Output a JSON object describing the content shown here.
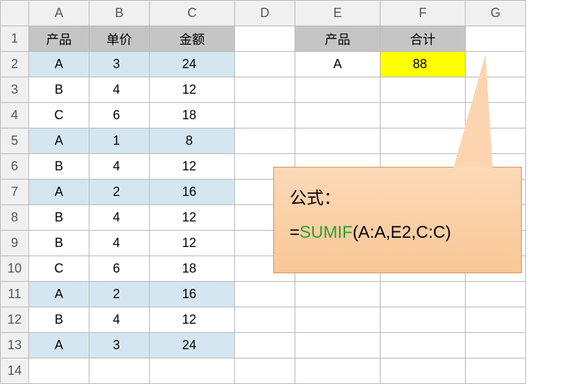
{
  "columns": [
    "A",
    "B",
    "C",
    "D",
    "E",
    "F",
    "G"
  ],
  "rowNumbers": [
    "1",
    "2",
    "3",
    "4",
    "5",
    "6",
    "7",
    "8",
    "9",
    "10",
    "11",
    "12",
    "13",
    "14"
  ],
  "mainHeaders": {
    "A": "产品",
    "B": "单价",
    "C": "金额"
  },
  "mainData": [
    {
      "product": "A",
      "price": "3",
      "amount": "24",
      "highlight": true
    },
    {
      "product": "B",
      "price": "4",
      "amount": "12",
      "highlight": false
    },
    {
      "product": "C",
      "price": "6",
      "amount": "18",
      "highlight": false
    },
    {
      "product": "A",
      "price": "1",
      "amount": "8",
      "highlight": true
    },
    {
      "product": "B",
      "price": "4",
      "amount": "12",
      "highlight": false
    },
    {
      "product": "A",
      "price": "2",
      "amount": "16",
      "highlight": true
    },
    {
      "product": "B",
      "price": "4",
      "amount": "12",
      "highlight": false
    },
    {
      "product": "B",
      "price": "4",
      "amount": "12",
      "highlight": false
    },
    {
      "product": "C",
      "price": "6",
      "amount": "18",
      "highlight": false
    },
    {
      "product": "A",
      "price": "2",
      "amount": "16",
      "highlight": true
    },
    {
      "product": "B",
      "price": "4",
      "amount": "12",
      "highlight": false
    },
    {
      "product": "A",
      "price": "3",
      "amount": "24",
      "highlight": true
    }
  ],
  "summaryHeaders": {
    "E": "产品",
    "F": "合计"
  },
  "summaryData": {
    "product": "A",
    "total": "88"
  },
  "callout": {
    "label": "公式：",
    "prefix": "=",
    "func": "SUMIF",
    "args": "(A:A,E2,C:C)"
  }
}
